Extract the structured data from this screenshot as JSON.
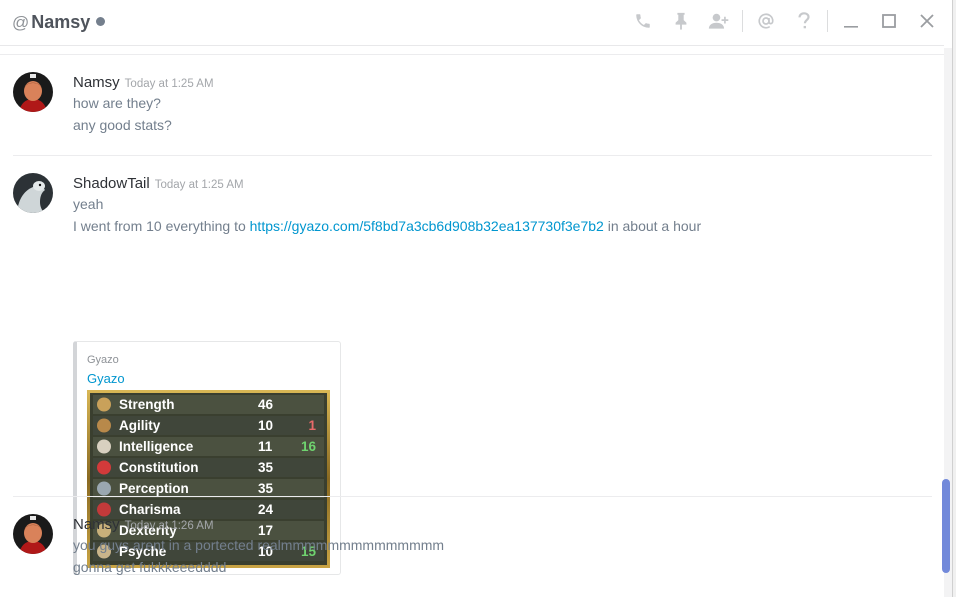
{
  "header": {
    "at_symbol": "@",
    "channel_name": "Namsy",
    "status_color": "#747f8d"
  },
  "toolbar": {
    "icons": [
      "phone-icon",
      "pin-icon",
      "add-friend-icon",
      "mention-icon",
      "help-icon",
      "minimize-icon",
      "maximize-icon",
      "close-icon"
    ]
  },
  "messages": [
    {
      "author": "Namsy",
      "timestamp": "Today at 1:25 AM",
      "lines": [
        "how are they?",
        "any good stats?"
      ]
    },
    {
      "author": "ShadowTail",
      "timestamp": "Today at 1:25 AM",
      "line1": "yeah",
      "line2_before": "I went from 10 everything to ",
      "line2_link": "https://gyazo.com/5f8bd7a3cb6d908b32ea137730f3e7b2",
      "line2_after": " in about a hour",
      "embed": {
        "provider": "Gyazo",
        "title": "Gyazo",
        "stats": [
          {
            "name": "Strength",
            "value": "46",
            "bonus": "",
            "bonus_color": ""
          },
          {
            "name": "Agility",
            "value": "10",
            "bonus": "1",
            "bonus_color": "#e86a6a"
          },
          {
            "name": "Intelligence",
            "value": "11",
            "bonus": "16",
            "bonus_color": "#6fd36f"
          },
          {
            "name": "Constitution",
            "value": "35",
            "bonus": "",
            "bonus_color": ""
          },
          {
            "name": "Perception",
            "value": "35",
            "bonus": "",
            "bonus_color": ""
          },
          {
            "name": "Charisma",
            "value": "24",
            "bonus": "",
            "bonus_color": ""
          },
          {
            "name": "Dexterity",
            "value": "17",
            "bonus": "",
            "bonus_color": ""
          },
          {
            "name": "Psyche",
            "value": "10",
            "bonus": "15",
            "bonus_color": "#6fd36f"
          }
        ]
      }
    },
    {
      "author": "Namsy",
      "timestamp": "Today at 1:26 AM",
      "lines": [
        "you guys arent in a portected realmmmmmmmmmmmmmm",
        "gonna get fukkkeeedddd"
      ]
    }
  ],
  "colors": {
    "accent": "#7289da",
    "link": "#0096cf"
  }
}
